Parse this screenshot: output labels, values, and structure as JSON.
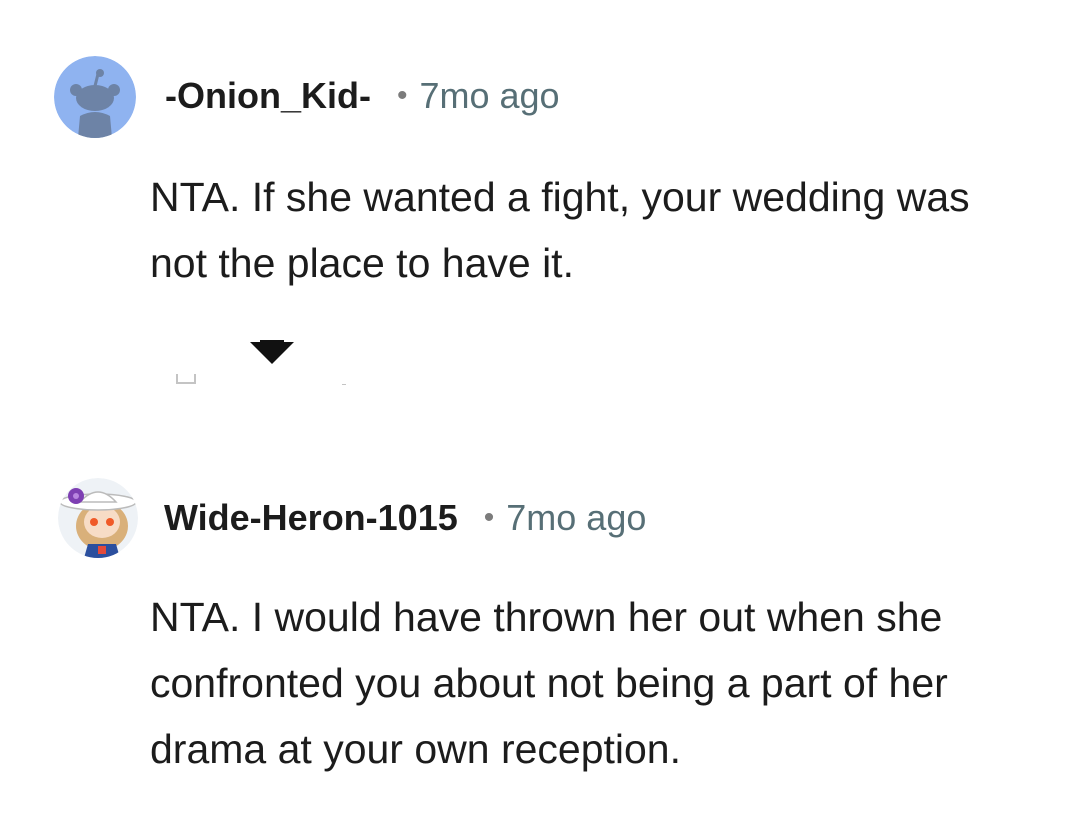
{
  "comments": [
    {
      "username": "-Onion_Kid-",
      "separator": "•",
      "time": "7mo ago",
      "body": "NTA. If she wanted a fight, your wedding was not the place to have it.",
      "avatar": "default-snoo-avatar",
      "avatar_color": "#8fb3f0"
    },
    {
      "username": "Wide-Heron-1015",
      "separator": "•",
      "time": "7mo ago",
      "body": "NTA. I would have thrown her out when she confronted you about not being a part of her drama at your own reception.",
      "avatar": "custom-hat-avatar",
      "avatar_color": "#eef2f6"
    }
  ],
  "colors": {
    "text": "#1c1c1c",
    "meta": "#576f76"
  }
}
